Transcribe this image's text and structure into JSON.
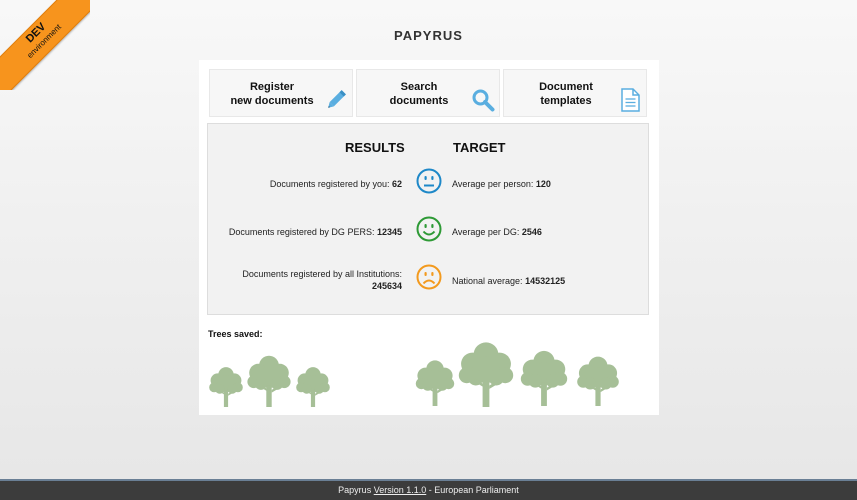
{
  "ribbon": {
    "line1": "DEV",
    "line2": "environment"
  },
  "app": {
    "title": "PAPYRUS"
  },
  "tiles": [
    {
      "line1": "Register",
      "line2": "new documents",
      "icon": "pencil-icon"
    },
    {
      "line1": "Search",
      "line2": "documents",
      "icon": "magnifier-icon"
    },
    {
      "line1": "Document",
      "line2": "templates",
      "icon": "document-icon"
    }
  ],
  "results": {
    "results_heading": "RESULTS",
    "target_heading": "TARGET",
    "rows": [
      {
        "left_label": "Documents registered by you:",
        "left_value": "62",
        "right_label": "Average per person:",
        "right_value": "120",
        "mood": "neutral-face-icon",
        "color": "#1e88c8"
      },
      {
        "left_label": "Documents registered by DG PERS:",
        "left_value": "12345",
        "right_label": "Average per DG:",
        "right_value": "2546",
        "mood": "smile-face-icon",
        "color": "#2e9a36"
      },
      {
        "left_label": "Documents registered by all Institutions:",
        "left_value": "245634",
        "right_label": "National average:",
        "right_value": "14532125",
        "mood": "sad-face-icon",
        "color": "#f39a1e"
      }
    ]
  },
  "trees": {
    "label": "Trees saved:",
    "color": "#a6bf97"
  },
  "footer": {
    "prefix": "Papyrus ",
    "version": "Version 1.1.0",
    "suffix": " - European Parliament"
  }
}
